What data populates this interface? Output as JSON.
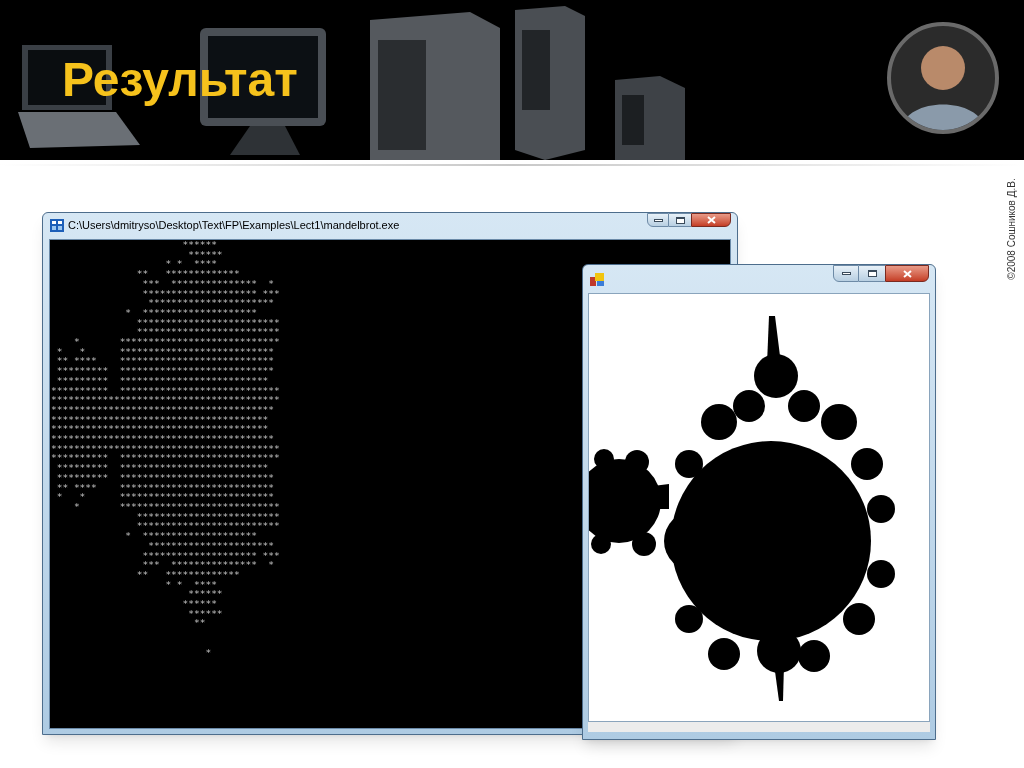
{
  "slide": {
    "title": "Результат",
    "copyright": "©2008 Сошников Д.В."
  },
  "console_window": {
    "title": "C:\\Users\\dmitryso\\Desktop\\Text\\FP\\Examples\\Lect1\\mandelbrot.exe",
    "output": "                       ******\n                        ******\n                    * *  ****\n               **   *************\n                ***  ***************  *\n                ******************** ***\n                 **********************\n             *  ********************\n               *************************\n               *************************\n    *       ****************************\n *   *      ***************************\n ** ****    ***************************\n *********  ***************************\n *********  **************************\n**********  ****************************\n****************************************\n***************************************\n**************************************\n**************************************\n***************************************\n****************************************\n**********  ****************************\n *********  **************************\n *********  ***************************\n ** ****    ***************************\n *   *      ***************************\n    *       ****************************\n               *************************\n               *************************\n             *  ********************\n                 **********************\n                ******************** ***\n                ***  ***************  *\n               **   *************\n                    * *  ****\n                        ******\n                       ******\n                        ******\n                         **\n\n\n                           *"
  }
}
